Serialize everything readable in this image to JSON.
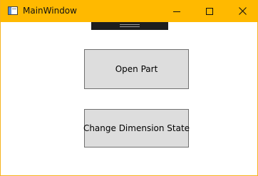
{
  "window": {
    "title": "MainWindow",
    "accent_color": "#ffb900"
  },
  "caption_buttons": {
    "minimize_icon": "minimize-icon",
    "maximize_icon": "maximize-icon",
    "close_icon": "close-icon"
  },
  "main": {
    "open_part_label": "Open Part",
    "change_dimension_state_label": "Change Dimension State"
  }
}
